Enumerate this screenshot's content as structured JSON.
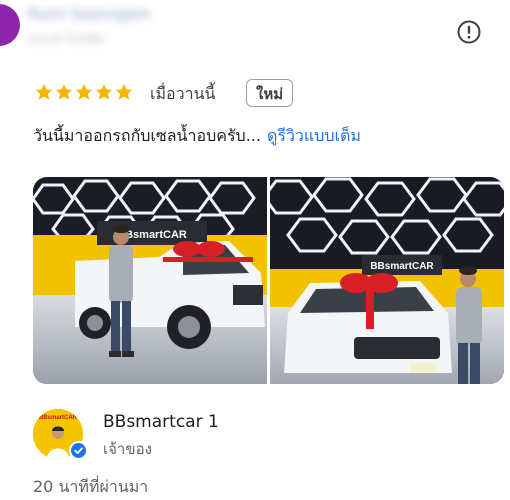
{
  "reviewer": {
    "name": "Rumi Soonngam",
    "meta": "Local Guide"
  },
  "review": {
    "rating": 5,
    "rating_max": 5,
    "time": "เมื่อวานนี้",
    "new_badge": "ใหม่",
    "text": "วันนี้มาออกรถกับเซลน้ำอบครับ...",
    "read_more": "ดูรีวิวแบบเต็ม",
    "photo_signs": [
      "BBsmartCAR",
      "BBsmartCAR"
    ]
  },
  "owner_response": {
    "name": "BBsmartcar 1",
    "role": "เจ้าของ",
    "time": "20 นาทีที่ผ่านมา",
    "logo_text": "BBsmartCAR"
  },
  "icons": {
    "report": "exclamation-circle-icon",
    "star": "star-icon",
    "verified": "verified-check-icon"
  },
  "colors": {
    "star": "#f4b400",
    "link": "#1a73e8",
    "verified": "#1a73e8",
    "owner_logo_bg": "#f5c400"
  }
}
